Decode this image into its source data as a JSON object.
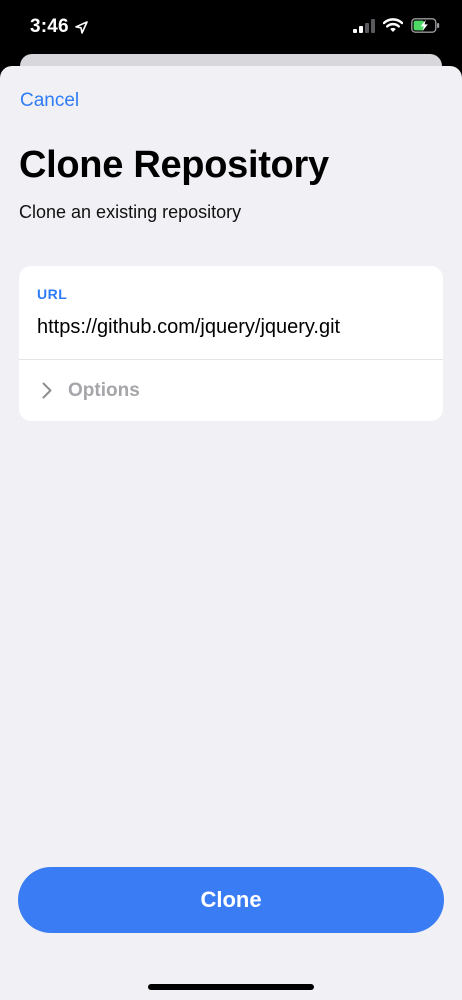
{
  "status_bar": {
    "time": "3:46",
    "location_icon": "location-arrow-icon",
    "signal_icon": "cellular-signal-icon",
    "wifi_icon": "wifi-icon",
    "battery_icon": "battery-charging-icon"
  },
  "nav": {
    "cancel_label": "Cancel"
  },
  "header": {
    "title": "Clone Repository",
    "subtitle": "Clone an existing repository"
  },
  "form": {
    "url_label": "URL",
    "url_value": "https://github.com/jquery/jquery.git",
    "options_label": "Options",
    "options_icon": "chevron-right-icon"
  },
  "actions": {
    "clone_label": "Clone"
  },
  "colors": {
    "accent": "#2f7cf6",
    "button": "#3a7cf3",
    "background": "#f0f0f5",
    "card": "#ffffff",
    "muted_text": "#a5a5aa"
  }
}
